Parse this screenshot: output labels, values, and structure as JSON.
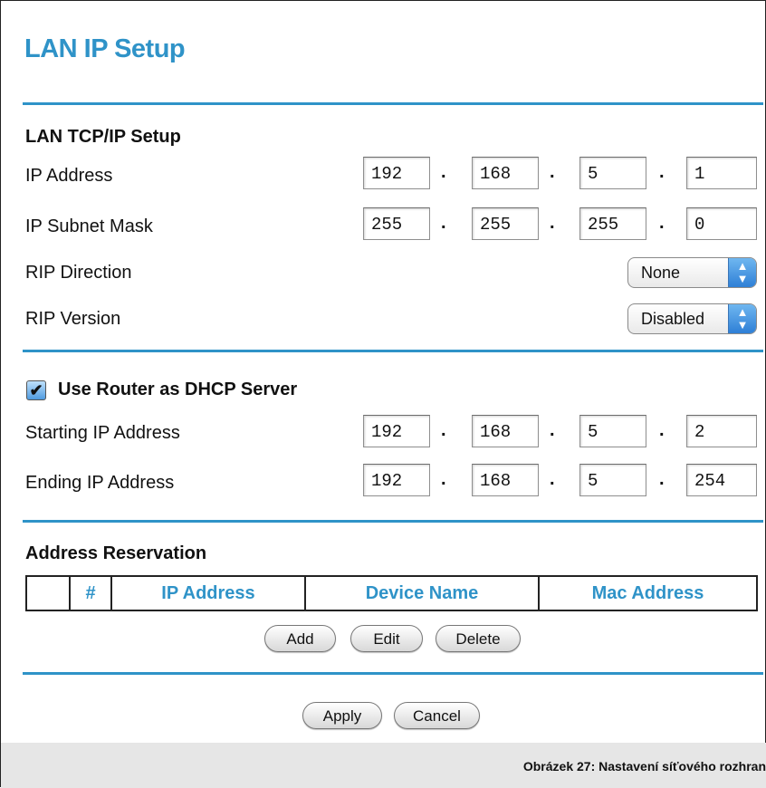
{
  "page": {
    "title": "LAN IP Setup"
  },
  "lan": {
    "section_title": "LAN TCP/IP Setup",
    "ip_address": {
      "label": "IP Address",
      "octets": [
        "192",
        "168",
        "5",
        "1"
      ]
    },
    "subnet_mask": {
      "label": "IP Subnet Mask",
      "octets": [
        "255",
        "255",
        "255",
        "0"
      ]
    },
    "rip_direction": {
      "label": "RIP Direction",
      "value": "None"
    },
    "rip_version": {
      "label": "RIP Version",
      "value": "Disabled"
    }
  },
  "dhcp": {
    "checkbox_label": "Use Router as DHCP Server",
    "checked": true,
    "start": {
      "label": "Starting IP Address",
      "octets": [
        "192",
        "168",
        "5",
        "2"
      ]
    },
    "end": {
      "label": "Ending IP Address",
      "octets": [
        "192",
        "168",
        "5",
        "254"
      ]
    }
  },
  "reservation": {
    "section_title": "Address Reservation",
    "columns": [
      "",
      "#",
      "IP Address",
      "Device Name",
      "Mac Address"
    ],
    "buttons": {
      "add": "Add",
      "edit": "Edit",
      "delete": "Delete"
    }
  },
  "actions": {
    "apply": "Apply",
    "cancel": "Cancel"
  },
  "caption": "Obrázek 27: Nastavení síťového rozhran",
  "colors": {
    "accent": "#2f93c8",
    "select_arrow": "#2e7fd6"
  }
}
